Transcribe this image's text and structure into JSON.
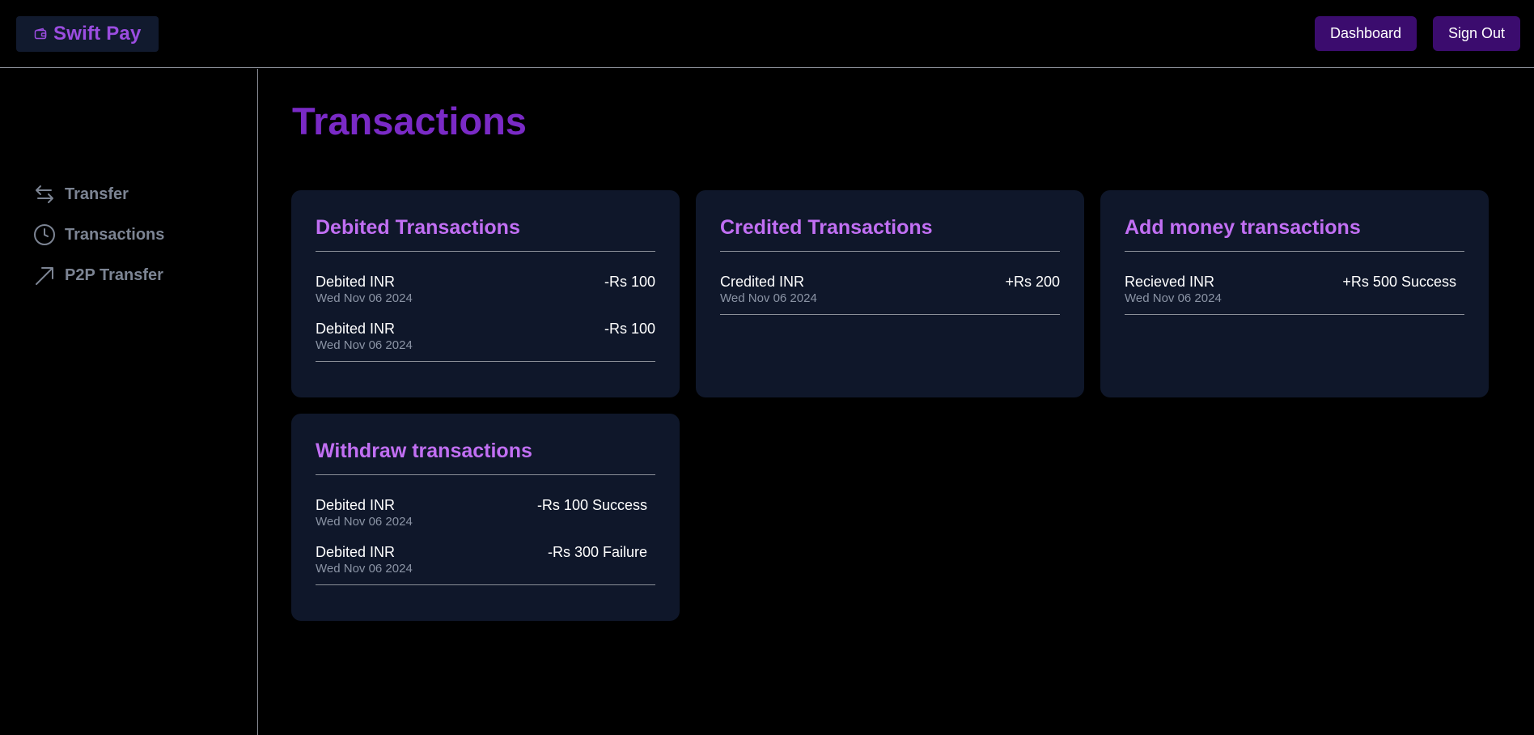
{
  "header": {
    "brand": "Swift Pay",
    "dashboard_label": "Dashboard",
    "signout_label": "Sign Out"
  },
  "sidebar": {
    "items": [
      {
        "label": "Transfer",
        "icon": "arrows-left-right-icon"
      },
      {
        "label": "Transactions",
        "icon": "clock-icon"
      },
      {
        "label": "P2P Transfer",
        "icon": "arrow-up-right-icon"
      }
    ]
  },
  "main": {
    "title": "Transactions",
    "cards": [
      {
        "title": "Debited Transactions",
        "rows": [
          {
            "label": "Debited INR",
            "date": "Wed Nov 06 2024",
            "amount": "-Rs 100"
          },
          {
            "label": "Debited INR",
            "date": "Wed Nov 06 2024",
            "amount": "-Rs 100"
          }
        ]
      },
      {
        "title": "Credited Transactions",
        "rows": [
          {
            "label": "Credited INR",
            "date": "Wed Nov 06 2024",
            "amount": "+Rs 200"
          }
        ]
      },
      {
        "title": "Add money transactions",
        "rows": [
          {
            "label": "Recieved INR",
            "date": "Wed Nov 06 2024",
            "amount": "+Rs 500 Success"
          }
        ]
      },
      {
        "title": "Withdraw transactions",
        "rows": [
          {
            "label": "Debited INR",
            "date": "Wed Nov 06 2024",
            "amount": "-Rs 100 Success"
          },
          {
            "label": "Debited INR",
            "date": "Wed Nov 06 2024",
            "amount": "-Rs 300 Failure"
          }
        ]
      }
    ]
  },
  "colors": {
    "brand": "#9b4de0",
    "button_bg": "#3b0c6e",
    "card_bg": "#0f172a",
    "card_title": "#c16ff3",
    "page_title": "#7a2ac6",
    "sidebar_text": "#7c8493"
  }
}
